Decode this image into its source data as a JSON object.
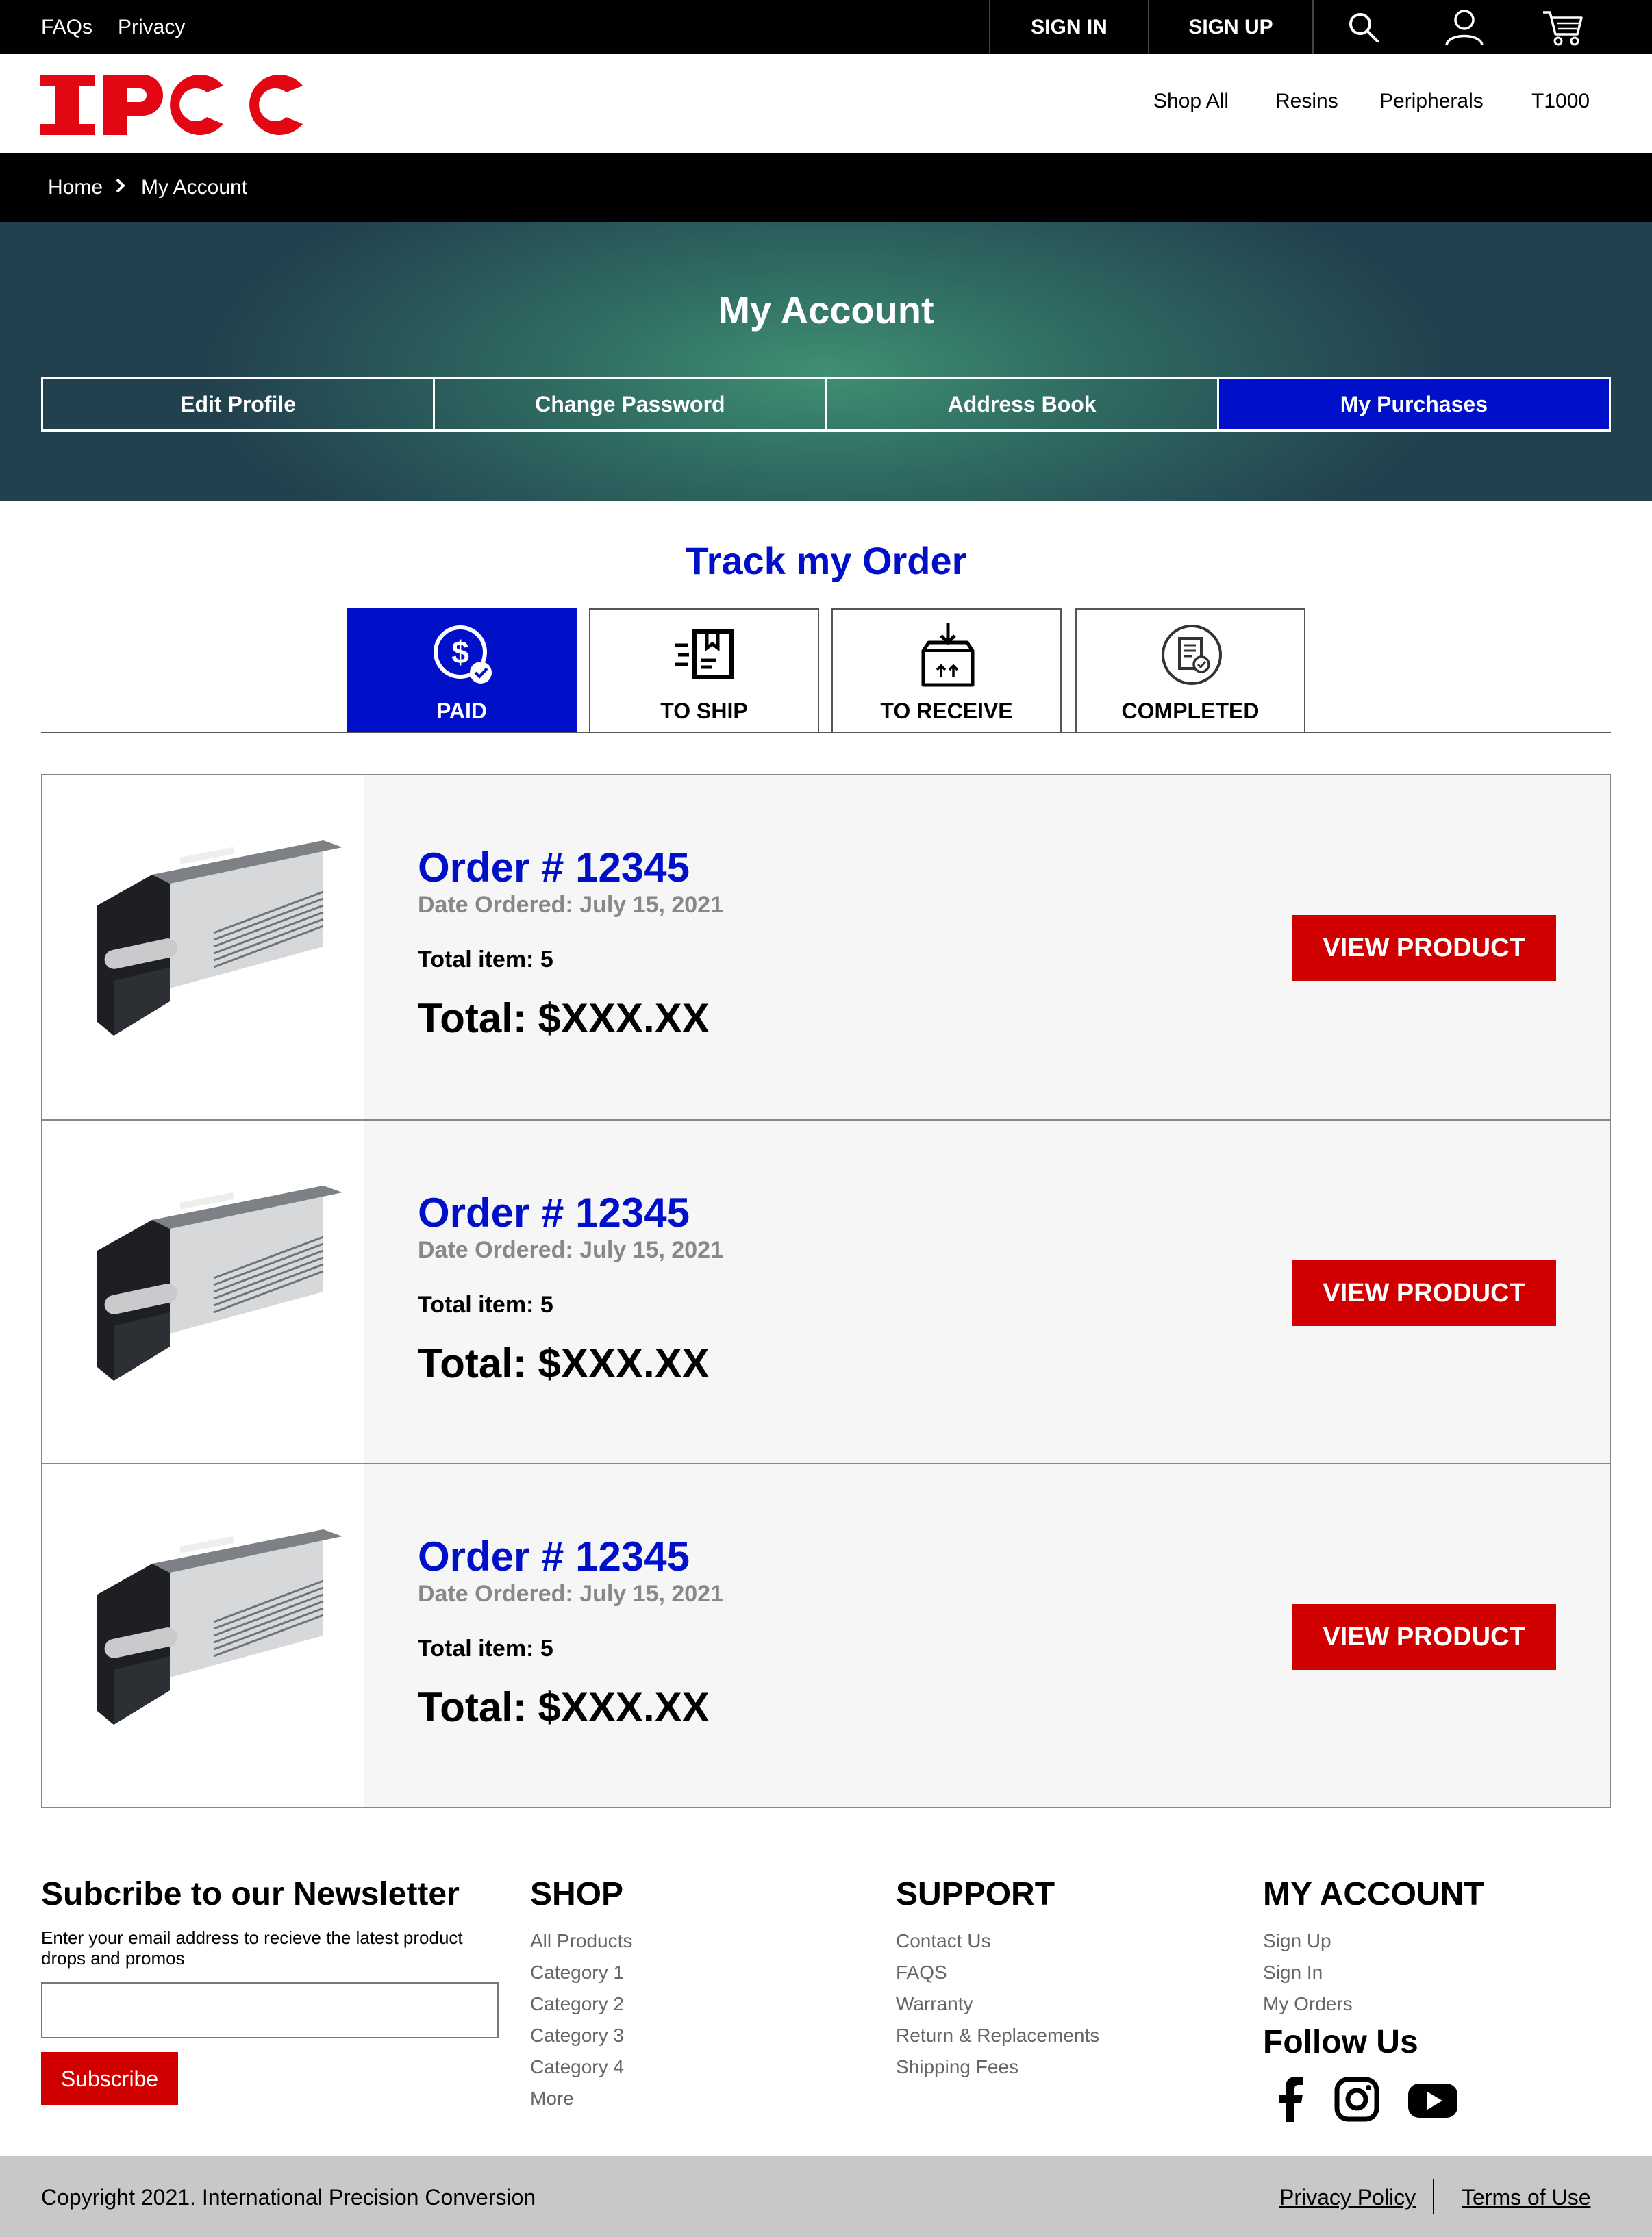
{
  "topbar": {
    "links": [
      "FAQs",
      "Privacy"
    ],
    "sign_in": "SIGN IN",
    "sign_up": "SIGN UP",
    "icons": [
      "search-icon",
      "user-icon",
      "cart-icon"
    ]
  },
  "brand": {
    "logo_text": "IPCC",
    "color": "#e30613"
  },
  "nav": [
    "Shop All",
    "Resins",
    "Peripherals",
    "T1000"
  ],
  "breadcrumb": [
    "Home",
    "My Account"
  ],
  "hero": {
    "title": "My Account",
    "tabs": [
      "Edit Profile",
      "Change Password",
      "Address Book",
      "My Purchases"
    ],
    "active_tab": "My Purchases"
  },
  "track": {
    "title": "Track my Order",
    "statuses": [
      {
        "label": "PAID",
        "icon": "dollar-check-icon",
        "active": true
      },
      {
        "label": "TO SHIP",
        "icon": "shipping-box-icon",
        "active": false
      },
      {
        "label": "TO RECEIVE",
        "icon": "receive-box-icon",
        "active": false
      },
      {
        "label": "COMPLETED",
        "icon": "completed-document-icon",
        "active": false
      }
    ]
  },
  "orders": [
    {
      "number": "Order # 12345",
      "date": "Date Ordered: July 15, 2021",
      "items": "Total item: 5",
      "total": "Total: $XXX.XX",
      "button": "VIEW PRODUCT"
    },
    {
      "number": "Order # 12345",
      "date": "Date Ordered: July 15, 2021",
      "items": "Total item: 5",
      "total": "Total: $XXX.XX",
      "button": "VIEW PRODUCT"
    },
    {
      "number": "Order # 12345",
      "date": "Date Ordered: July 15, 2021",
      "items": "Total item: 5",
      "total": "Total: $XXX.XX",
      "button": "VIEW PRODUCT"
    }
  ],
  "footer": {
    "newsletter": {
      "title": "Subcribe to our Newsletter",
      "desc": "Enter your email address to recieve the latest product drops and promos",
      "input_value": "",
      "button": "Subscribe"
    },
    "shop": {
      "title": "SHOP",
      "links": [
        "All Products",
        "Category 1",
        "Category 2",
        "Category 3",
        "Category 4",
        "More"
      ]
    },
    "support": {
      "title": "SUPPORT",
      "links": [
        "Contact Us",
        "FAQS",
        "Warranty",
        "Return & Replacements",
        "Shipping Fees"
      ]
    },
    "account": {
      "title": "MY ACCOUNT",
      "links": [
        "Sign Up",
        "Sign In",
        "My Orders"
      ]
    },
    "follow": {
      "title": "Follow Us",
      "icons": [
        "facebook-icon",
        "instagram-icon",
        "youtube-icon"
      ]
    },
    "copyright": "Copyright 2021. International Precision Conversion",
    "legal": [
      "Privacy Policy",
      "Terms of Use"
    ]
  },
  "colors": {
    "accent_blue": "#0010c8",
    "brand_red": "#d10000"
  }
}
